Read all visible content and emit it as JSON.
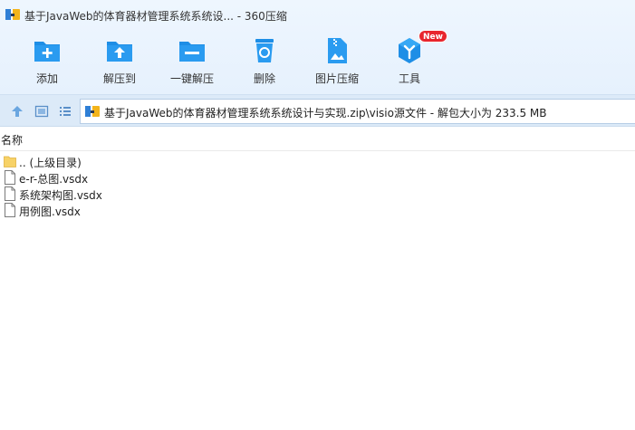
{
  "window": {
    "title": "基于JavaWeb的体育器材管理系统系统设... - 360压缩"
  },
  "toolbar": {
    "items": [
      {
        "label": "添加",
        "icon": "add-icon"
      },
      {
        "label": "解压到",
        "icon": "extract-to-icon"
      },
      {
        "label": "一键解压",
        "icon": "one-click-extract-icon"
      },
      {
        "label": "删除",
        "icon": "delete-icon"
      },
      {
        "label": "图片压缩",
        "icon": "image-compress-icon"
      },
      {
        "label": "工具",
        "icon": "tools-icon",
        "badge": "New"
      }
    ]
  },
  "nav": {
    "address": "基于JavaWeb的体育器材管理系统系统设计与实现.zip\\visio源文件 - 解包大小为 233.5 MB"
  },
  "list": {
    "column_name": "名称",
    "rows": [
      {
        "name": ".. (上级目录)",
        "type": "folder"
      },
      {
        "name": "e-r-总图.vsdx",
        "type": "file"
      },
      {
        "name": "系统架构图.vsdx",
        "type": "file"
      },
      {
        "name": "用例图.vsdx",
        "type": "file"
      }
    ]
  },
  "colors": {
    "accent": "#1e8ee6",
    "toolbar_bg": "#eaf4fe",
    "nav_bg": "#dceaf8",
    "badge": "#e8262d"
  }
}
